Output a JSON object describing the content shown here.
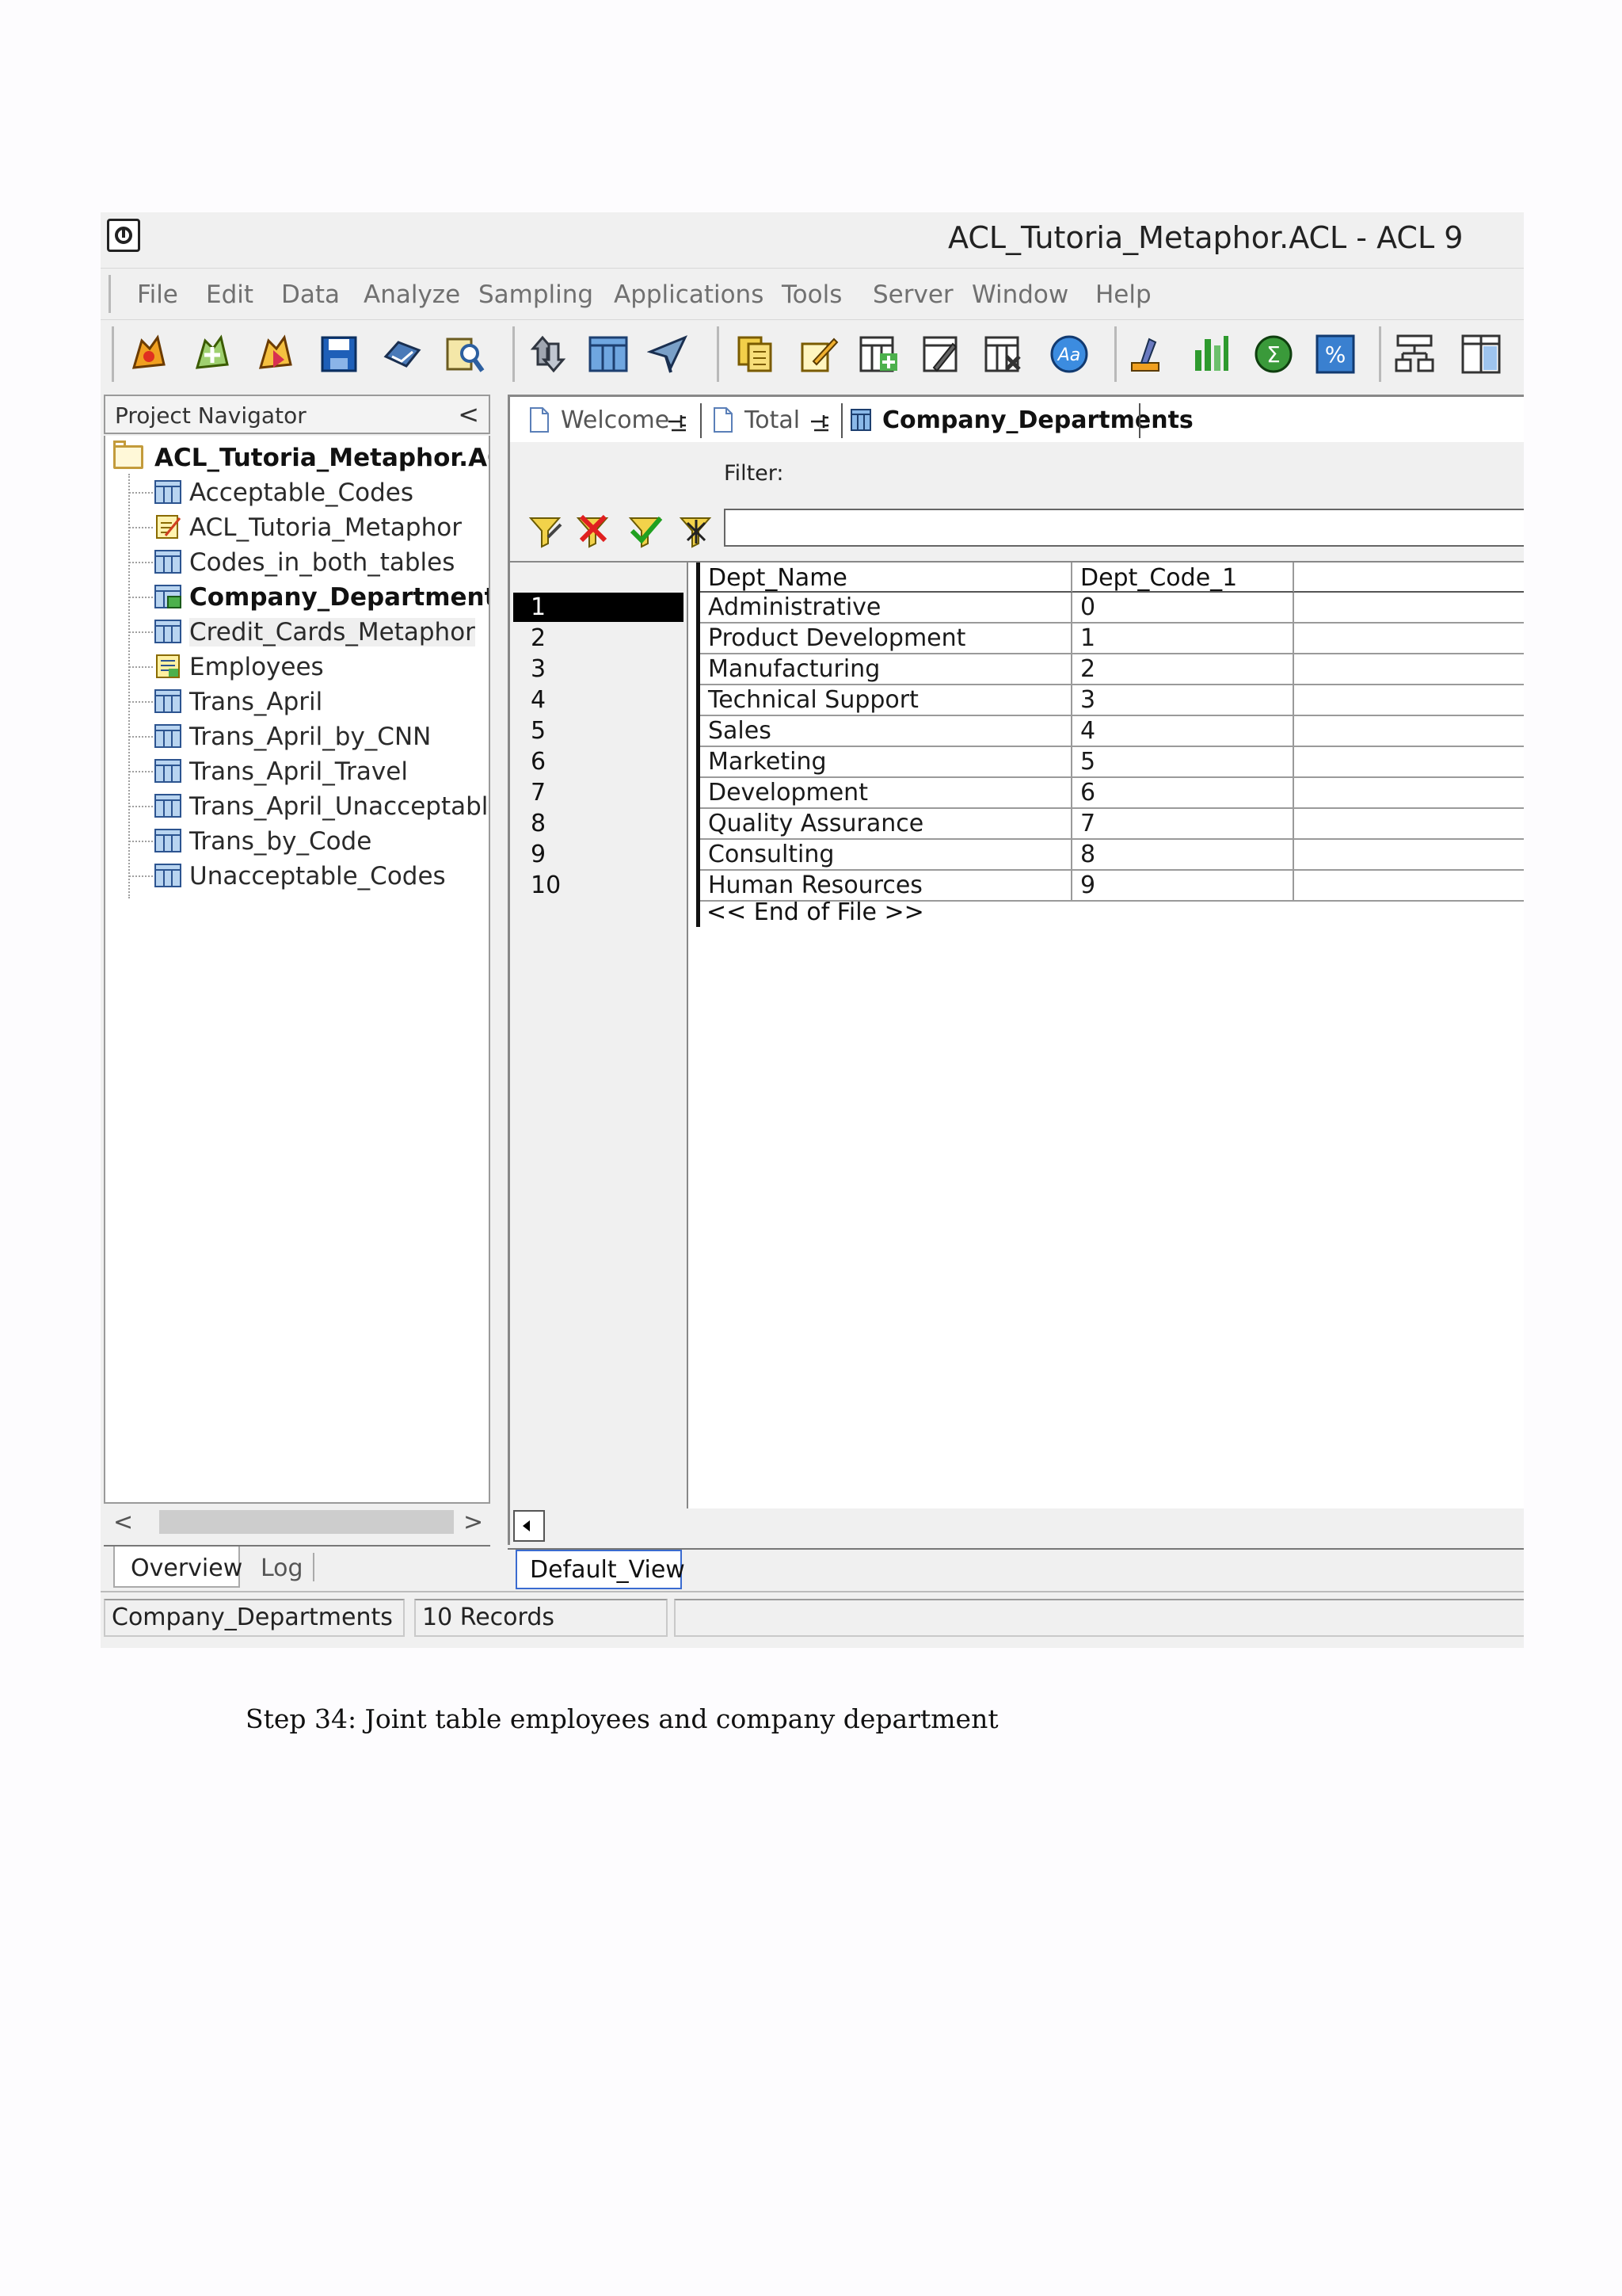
{
  "window": {
    "title": "ACL_Tutoria_Metaphor.ACL - ACL 9"
  },
  "menu": [
    "File",
    "Edit",
    "Data",
    "Analyze",
    "Sampling",
    "Applications",
    "Tools",
    "Server",
    "Window",
    "Help"
  ],
  "toolbar_icons": [
    "open-project-icon",
    "new-project-icon",
    "open-table-icon",
    "save-icon",
    "print-icon",
    "find-icon",
    "refresh-icon",
    "table-layout-icon",
    "history-icon",
    "copy-table-icon",
    "edit-definition-icon",
    "add-column-icon",
    "edit-column-icon",
    "remove-column-icon",
    "font-icon",
    "verify-icon",
    "statistics-icon",
    "total-icon",
    "percent-icon",
    "structure-icon",
    "split-view-icon"
  ],
  "navigator": {
    "title": "Project Navigator",
    "collapse_glyph": "<",
    "root": "ACL_Tutoria_Metaphor.ACL",
    "items": [
      {
        "label": "Acceptable_Codes",
        "icon": "table-icon"
      },
      {
        "label": "ACL_Tutoria_Metaphor",
        "icon": "script-icon"
      },
      {
        "label": "Codes_in_both_tables",
        "icon": "table-icon"
      },
      {
        "label": "Company_Departments",
        "icon": "open-table-icon"
      },
      {
        "label": "Credit_Cards_Metaphor",
        "icon": "table-icon"
      },
      {
        "label": "Employees",
        "icon": "log-icon"
      },
      {
        "label": "Trans_April",
        "icon": "table-icon"
      },
      {
        "label": "Trans_April_by_CNN",
        "icon": "table-icon"
      },
      {
        "label": "Trans_April_Travel",
        "icon": "table-icon"
      },
      {
        "label": "Trans_April_Unacceptable",
        "icon": "table-icon"
      },
      {
        "label": "Trans_by_Code",
        "icon": "table-icon"
      },
      {
        "label": "Unacceptable_Codes",
        "icon": "table-icon"
      }
    ],
    "scroll_left": "<",
    "scroll_right": ">",
    "tabs": [
      "Overview",
      "Log"
    ]
  },
  "doc_tabs": [
    {
      "label": "Welcome",
      "active": false
    },
    {
      "label": "Total",
      "active": false
    },
    {
      "label": "Company_Departments",
      "active": true
    }
  ],
  "filter": {
    "label": "Filter:",
    "value": ""
  },
  "table": {
    "columns": [
      "Dept_Name",
      "Dept_Code_1"
    ],
    "rows": [
      {
        "n": "1",
        "name": "Administrative",
        "code": "0"
      },
      {
        "n": "2",
        "name": "Product Development",
        "code": "1"
      },
      {
        "n": "3",
        "name": "Manufacturing",
        "code": "2"
      },
      {
        "n": "4",
        "name": "Technical Support",
        "code": "3"
      },
      {
        "n": "5",
        "name": "Sales",
        "code": "4"
      },
      {
        "n": "6",
        "name": "Marketing",
        "code": "5"
      },
      {
        "n": "7",
        "name": "Development",
        "code": "6"
      },
      {
        "n": "8",
        "name": "Quality Assurance",
        "code": "7"
      },
      {
        "n": "9",
        "name": "Consulting",
        "code": "8"
      },
      {
        "n": "10",
        "name": "Human Resources",
        "code": "9"
      }
    ],
    "end_of_file": "<< End of File >>"
  },
  "view_tab": "Default_View",
  "status": {
    "table": "Company_Departments",
    "records": "10 Records"
  },
  "caption": "Step 34: Joint table employees and company department"
}
